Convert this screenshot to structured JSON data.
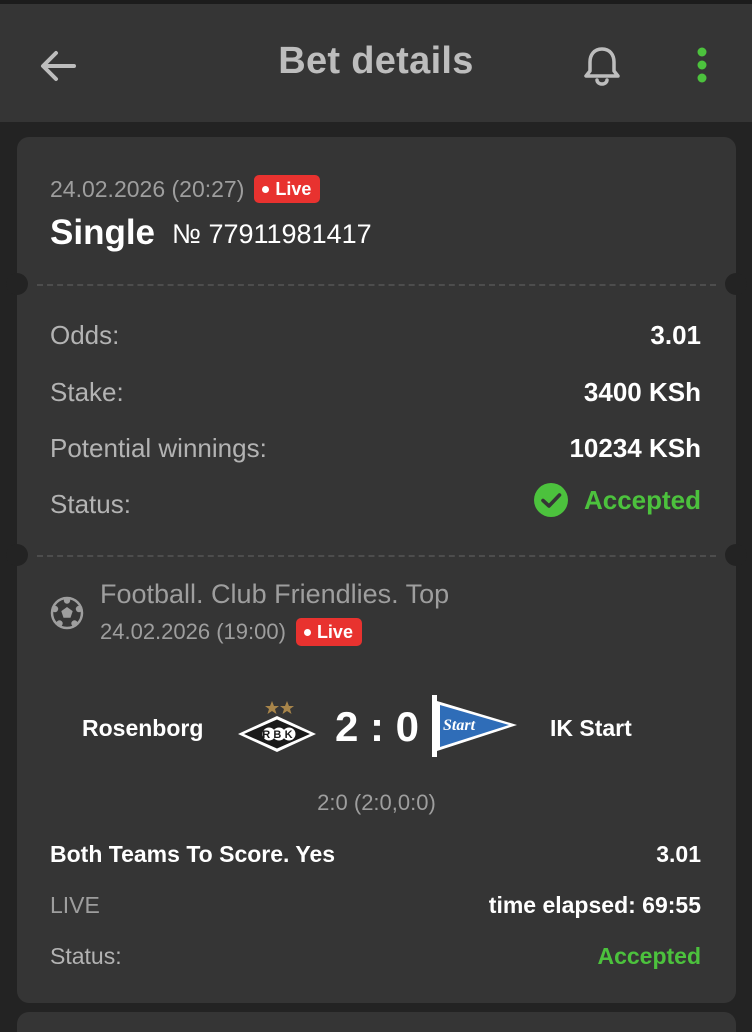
{
  "header": {
    "title": "Bet details",
    "back_icon": "arrow-left-icon",
    "bell_icon": "bell-icon",
    "menu_icon": "more-vertical-icon",
    "menu_color": "#4cc23d"
  },
  "bet": {
    "date": "24.02.2026 (20:27)",
    "live_label": "Live",
    "type": "Single",
    "number": "№ 77911981417",
    "odds_label": "Odds:",
    "odds_value": "3.01",
    "stake_label": "Stake:",
    "stake_value": "3400 KSh",
    "winnings_label": "Potential winnings:",
    "winnings_value": "10234 KSh",
    "status_label": "Status:",
    "status_value": "Accepted",
    "status_color": "#4cc23d"
  },
  "event": {
    "sport_icon": "football-icon",
    "league": "Football. Club Friendlies. Top",
    "date": "24.02.2026 (19:00)",
    "live_label": "Live",
    "home_team": "Rosenborg",
    "away_team": "IK Start",
    "score": "2 : 0",
    "score_detail": "2:0 (2:0,0:0)",
    "market": "Both Teams To Score. Yes",
    "market_odds": "3.01",
    "live_text": "LIVE",
    "elapsed": "time elapsed: 69:55",
    "status_label": "Status:",
    "status_value": "Accepted"
  },
  "logos": {
    "home_logo_text": "RBK",
    "away_logo_text": "Start"
  },
  "colors": {
    "live_badge": "#e8322f",
    "accent_green": "#4cc23d"
  }
}
